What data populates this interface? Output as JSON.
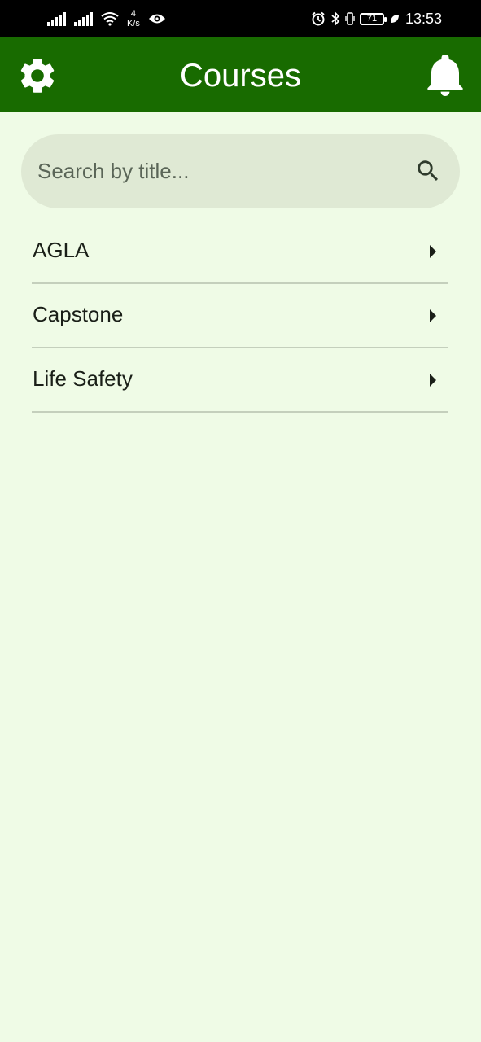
{
  "status_bar": {
    "speed_value": "4",
    "speed_unit": "K/s",
    "battery": "71",
    "time": "13:53"
  },
  "app_bar": {
    "title": "Courses",
    "color": "#186b00"
  },
  "search": {
    "placeholder": "Search by title..."
  },
  "courses": [
    {
      "label": "AGLA"
    },
    {
      "label": "Capstone"
    },
    {
      "label": "Life Safety"
    }
  ],
  "icons": {
    "settings": "gear-icon",
    "notifications": "bell-icon",
    "search": "search-icon",
    "chevron": "caret-right-icon"
  }
}
